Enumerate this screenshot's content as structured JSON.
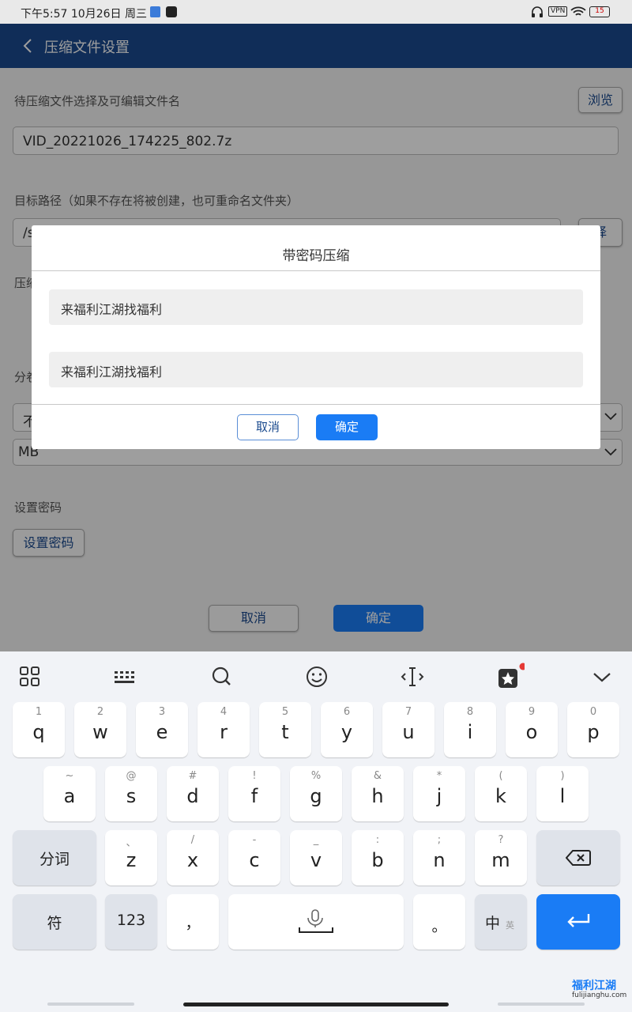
{
  "status_bar": {
    "time_date": "下午5:57  10月26日 周三",
    "vpn": "VPN",
    "battery": "15"
  },
  "app_bar": {
    "title": "压缩文件设置"
  },
  "form": {
    "file_label": "待压缩文件选择及可编辑文件名",
    "browse_button": "浏览",
    "file_name": "VID_20221026_174225_802.7z",
    "target_label": "目标路径（如果不存在将被创建，也可重命名文件夹）",
    "target_value": "/s",
    "choose_button": "择",
    "compress_label_partial": "压缩",
    "split_label_partial": "分卷",
    "split_value_partial": "不",
    "unit_value": "MB",
    "password_label": "设置密码",
    "set_password_button": "设置密码",
    "cancel_button": "取消",
    "confirm_button": "确定"
  },
  "dialog": {
    "title": "带密码压缩",
    "password": "来福利江湖找福利",
    "password_confirm": "来福利江湖找福利",
    "cancel": "取消",
    "confirm": "确定"
  },
  "keyboard": {
    "row1": [
      {
        "k": "q",
        "s": "1"
      },
      {
        "k": "w",
        "s": "2"
      },
      {
        "k": "e",
        "s": "3"
      },
      {
        "k": "r",
        "s": "4"
      },
      {
        "k": "t",
        "s": "5"
      },
      {
        "k": "y",
        "s": "6"
      },
      {
        "k": "u",
        "s": "7"
      },
      {
        "k": "i",
        "s": "8"
      },
      {
        "k": "o",
        "s": "9"
      },
      {
        "k": "p",
        "s": "0"
      }
    ],
    "row2": [
      {
        "k": "a",
        "s": "~"
      },
      {
        "k": "s",
        "s": "@"
      },
      {
        "k": "d",
        "s": "#"
      },
      {
        "k": "f",
        "s": "!"
      },
      {
        "k": "g",
        "s": "%"
      },
      {
        "k": "h",
        "s": "&"
      },
      {
        "k": "j",
        "s": "*"
      },
      {
        "k": "k",
        "s": "("
      },
      {
        "k": "l",
        "s": ")"
      }
    ],
    "row3": [
      {
        "k": "z",
        "s": "、"
      },
      {
        "k": "x",
        "s": "/"
      },
      {
        "k": "c",
        "s": "-"
      },
      {
        "k": "v",
        "s": "_"
      },
      {
        "k": "b",
        "s": ":"
      },
      {
        "k": "n",
        "s": ";"
      },
      {
        "k": "m",
        "s": "?"
      }
    ],
    "split_word": "分词",
    "symbols": "符",
    "numbers": "123",
    "comma": "，",
    "period": "。",
    "lang_main": "中",
    "lang_sub": "英",
    "colors": {
      "accent": "#1a7cf5",
      "appbar": "#1a4a8e"
    }
  },
  "watermark": {
    "brand": "福利江湖",
    "domain": "fulijianghu.com"
  }
}
